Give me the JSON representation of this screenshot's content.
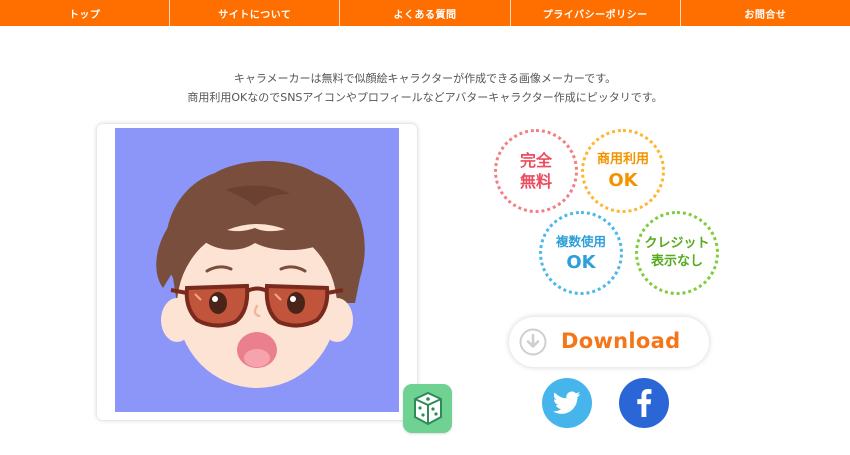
{
  "nav": {
    "items": [
      {
        "label": "トップ"
      },
      {
        "label": "サイトについて"
      },
      {
        "label": "よくある質問"
      },
      {
        "label": "プライバシーポリシー"
      },
      {
        "label": "お問合せ"
      }
    ]
  },
  "intro": {
    "line1": "キャラメーカーは無料で似顔絵キャラクターが作成できる画像メーカーです。",
    "line2": "商用利用OKなのでSNSアイコンやプロフィールなどアバターキャラクター作成にピッタリです。"
  },
  "badges": {
    "free": {
      "line1": "完全",
      "line2": "無料"
    },
    "commercial": {
      "line1": "商用利用",
      "line2": "OK"
    },
    "multiple": {
      "line1": "複数使用",
      "line2": "OK"
    },
    "credit": {
      "line1": "クレジット",
      "line2": "表示なし"
    }
  },
  "download": {
    "label": "Download",
    "icon": "download-arrow-icon"
  },
  "social": {
    "twitter": "twitter-icon",
    "facebook": "facebook-icon"
  },
  "randomize": {
    "icon": "dice-icon"
  },
  "colors": {
    "nav": "#ff6f00",
    "avatar_bg": "#8b96f8",
    "download_text": "#f57618",
    "twitter": "#45b5ec",
    "facebook": "#2a66d6",
    "dice": "#6fd292"
  }
}
